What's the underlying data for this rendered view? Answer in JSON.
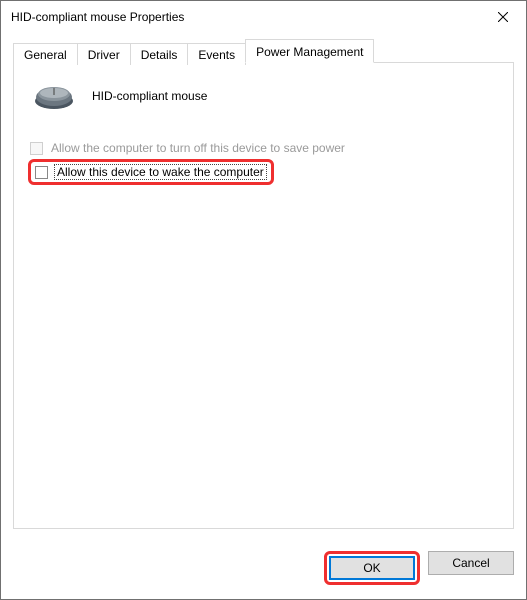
{
  "window": {
    "title": "HID-compliant mouse Properties"
  },
  "tabs": {
    "general": "General",
    "driver": "Driver",
    "details": "Details",
    "events": "Events",
    "power": "Power Management"
  },
  "device": {
    "name": "HID-compliant mouse"
  },
  "options": {
    "allow_turn_off": "Allow the computer to turn off this device to save power",
    "allow_wake": "Allow this device to wake the computer"
  },
  "buttons": {
    "ok": "OK",
    "cancel": "Cancel"
  }
}
